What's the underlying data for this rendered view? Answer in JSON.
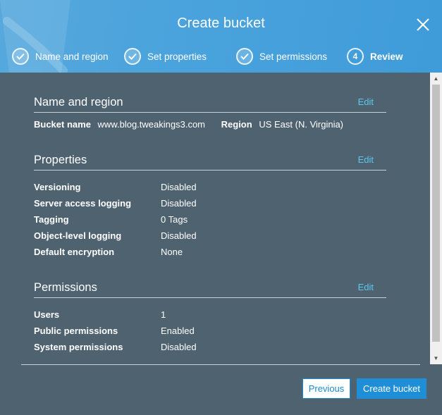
{
  "dialog": {
    "title": "Create bucket"
  },
  "steps": [
    {
      "number": "",
      "label": "Name and region",
      "state": "done"
    },
    {
      "number": "",
      "label": "Set properties",
      "state": "done"
    },
    {
      "number": "",
      "label": "Set permissions",
      "state": "done"
    },
    {
      "number": "4",
      "label": "Review",
      "state": "active"
    }
  ],
  "name_region": {
    "title": "Name and region",
    "edit": "Edit",
    "bucket_name_label": "Bucket name",
    "bucket_name_value": "www.blog.tweakings3.com",
    "region_label": "Region",
    "region_value": "US East (N. Virginia)"
  },
  "properties": {
    "title": "Properties",
    "edit": "Edit",
    "rows": [
      {
        "key": "Versioning",
        "value": "Disabled"
      },
      {
        "key": "Server access logging",
        "value": "Disabled"
      },
      {
        "key": "Tagging",
        "value": "0 Tags"
      },
      {
        "key": "Object-level logging",
        "value": "Disabled"
      },
      {
        "key": "Default encryption",
        "value": "None"
      }
    ]
  },
  "permissions": {
    "title": "Permissions",
    "edit": "Edit",
    "rows": [
      {
        "key": "Users",
        "value": "1"
      },
      {
        "key": "Public permissions",
        "value": "Enabled"
      },
      {
        "key": "System permissions",
        "value": "Disabled"
      }
    ]
  },
  "footer": {
    "previous": "Previous",
    "create": "Create bucket"
  },
  "colors": {
    "header": "#4aa3dc",
    "body": "#4e6270",
    "link": "#5cc7f0",
    "primary": "#1e8fd6"
  }
}
